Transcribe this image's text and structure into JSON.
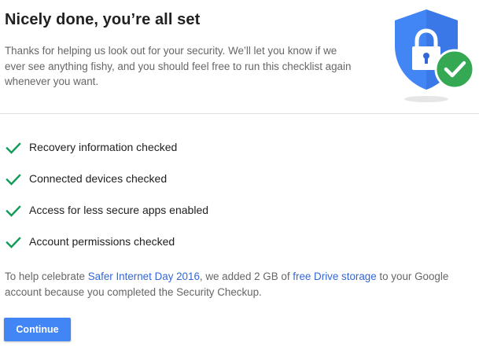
{
  "header": {
    "title": "Nicely done, you’re all set",
    "intro": "Thanks for helping us look out for your security. We’ll let you know if we ever see anything fishy, and you should feel free to run this checklist again whenever you want."
  },
  "checklist": {
    "items": [
      {
        "label": "Recovery information checked",
        "icon": "checkmark-icon"
      },
      {
        "label": "Connected devices checked",
        "icon": "checkmark-icon"
      },
      {
        "label": "Access for less secure apps enabled",
        "icon": "checkmark-icon"
      },
      {
        "label": "Account permissions checked",
        "icon": "checkmark-icon"
      }
    ]
  },
  "celebrate": {
    "prefix": "To help celebrate ",
    "link1": "Safer Internet Day 2016",
    "middle": ", we added 2 GB of ",
    "link2": "free Drive storage",
    "suffix": " to your Google account because you completed the Security Checkup."
  },
  "actions": {
    "continue_label": "Continue"
  },
  "colors": {
    "check_green": "#0f9d58",
    "shield_blue": "#4285f4",
    "shield_dark_blue": "#3367d6",
    "badge_green": "#34a853",
    "link_blue": "#3367d6",
    "button_blue": "#4285f4"
  },
  "icons": {
    "hero": "security-shield-lock-icon",
    "badge": "check-circle-icon"
  }
}
